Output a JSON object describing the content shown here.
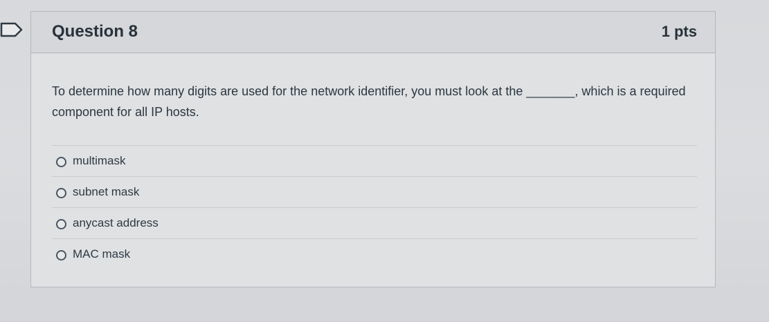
{
  "question": {
    "title": "Question 8",
    "points": "1 pts",
    "text": "To determine how many digits are used for the network identifier, you must look at the _______, which is a required component for all IP hosts."
  },
  "answers": [
    {
      "label": "multimask"
    },
    {
      "label": "subnet mask"
    },
    {
      "label": "anycast address"
    },
    {
      "label": "MAC mask"
    }
  ],
  "icons": {
    "flag": "bookmark-flag-icon",
    "radio": "radio-button-icon"
  },
  "colors": {
    "text": "#2d3b45",
    "header_bg": "#d5d7da",
    "border": "#b4b8bc"
  }
}
